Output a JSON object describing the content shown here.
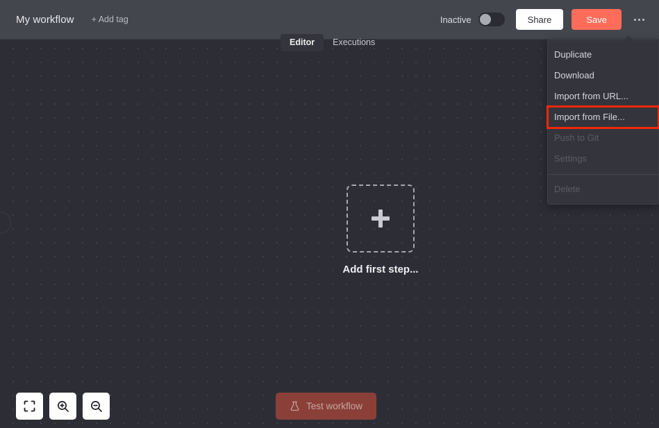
{
  "header": {
    "workflow_title": "My workflow",
    "add_tag_label": "+ Add tag",
    "activation_label": "Inactive",
    "activation_state": "off",
    "share_label": "Share",
    "save_label": "Save",
    "save_color": "#ff6d5a",
    "kebab_icon": "more-horizontal-icon"
  },
  "tabs": [
    {
      "label": "Editor",
      "active": true
    },
    {
      "label": "Executions",
      "active": false
    }
  ],
  "canvas": {
    "add_first_step_label": "Add first step...",
    "plus_icon": "plus-icon",
    "background": "#2d2e35",
    "dot_color": "#3e4047"
  },
  "zoom_controls": [
    {
      "icon": "fit-to-view-icon",
      "name": "zoom-to-fit-button"
    },
    {
      "icon": "zoom-in-icon",
      "name": "zoom-in-button"
    },
    {
      "icon": "zoom-out-icon",
      "name": "zoom-out-button"
    }
  ],
  "test_workflow": {
    "label": "Test workflow",
    "icon": "flask-icon",
    "disabled": true,
    "color": "#8a4038"
  },
  "menu": {
    "highlight_color": "#f0280a",
    "items": [
      {
        "label": "Duplicate",
        "disabled": false,
        "highlighted": false
      },
      {
        "label": "Download",
        "disabled": false,
        "highlighted": false
      },
      {
        "label": "Import from URL...",
        "disabled": false,
        "highlighted": false
      },
      {
        "label": "Import from File...",
        "disabled": false,
        "highlighted": true
      },
      {
        "label": "Push to Git",
        "disabled": true,
        "highlighted": false
      },
      {
        "label": "Settings",
        "disabled": true,
        "highlighted": false
      },
      {
        "label": "Delete",
        "disabled": true,
        "highlighted": false,
        "separator_before": true
      }
    ]
  }
}
